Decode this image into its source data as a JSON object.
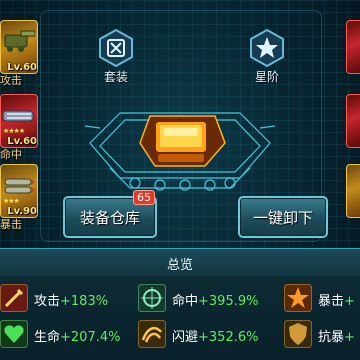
{
  "left_items": [
    {
      "level": "Lv.60",
      "tag": "攻击",
      "rarity": "gold"
    },
    {
      "level": "Lv.60",
      "tag": "命中",
      "rarity": "red"
    },
    {
      "level": "Lv.90",
      "tag": "暴击",
      "rarity": "gold"
    }
  ],
  "right_items": [
    {
      "rarity": "red"
    },
    {
      "rarity": "red"
    },
    {
      "rarity": "gold"
    }
  ],
  "top_buttons": {
    "set_label": "套装",
    "star_label": "星阶"
  },
  "warehouse": {
    "label": "装备仓库",
    "badge": "65"
  },
  "unequip": {
    "label": "一键卸下"
  },
  "overview": {
    "title": "总览",
    "stats": [
      {
        "name": "攻击",
        "value": "+183%",
        "icon": "attack-icon",
        "color": "#c8322a"
      },
      {
        "name": "命中",
        "value": "+395.9%",
        "icon": "crosshair-icon",
        "color": "#2f7a52"
      },
      {
        "name": "暴击",
        "value": "+",
        "icon": "crit-icon",
        "color": "#b25a10"
      },
      {
        "name": "生命",
        "value": "+207.4%",
        "icon": "heart-icon",
        "color": "#2b8a3a"
      },
      {
        "name": "闪避",
        "value": "+352.6%",
        "icon": "dodge-icon",
        "color": "#a06a1a"
      },
      {
        "name": "抗暴",
        "value": "+",
        "icon": "shield-icon",
        "color": "#8a5a1a"
      }
    ]
  }
}
